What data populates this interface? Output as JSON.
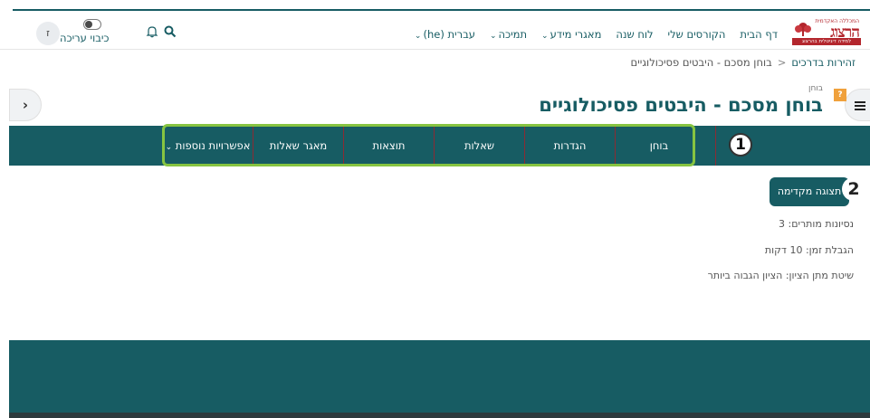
{
  "header": {
    "logo": {
      "small_text": "המכללה האקדמית",
      "main_text": "הרצוג",
      "strip_text": "למידה דיגיטלית בהרצוג"
    },
    "nav": [
      {
        "label": "דף הבית",
        "dropdown": false
      },
      {
        "label": "הקורסים שלי",
        "dropdown": false
      },
      {
        "label": "לוח שנה",
        "dropdown": false
      },
      {
        "label": "מאגרי מידע",
        "dropdown": true
      },
      {
        "label": "תמיכה",
        "dropdown": true
      },
      {
        "label": "עברית (he)",
        "dropdown": true
      }
    ],
    "edit_mode_label": "כיבוי עריכה",
    "lang_icon_text": "ז"
  },
  "breadcrumb": {
    "items": [
      "זהירות בדרכים",
      "בוחן מסכם - היבטים פסיכולוגיים"
    ],
    "separator": "<"
  },
  "page": {
    "label": "בוחן",
    "title": "בוחן מסכם - היבטים פסיכולוגיים",
    "badge": "?"
  },
  "tabs": [
    {
      "label": "בוחן",
      "dropdown": false
    },
    {
      "label": "הגדרות",
      "dropdown": false
    },
    {
      "label": "שאלות",
      "dropdown": false
    },
    {
      "label": "תוצאות",
      "dropdown": false
    },
    {
      "label": "מאגר שאלות",
      "dropdown": false
    },
    {
      "label": "אפשרויות נוספות",
      "dropdown": true
    }
  ],
  "callouts": {
    "one": "1",
    "two": "2"
  },
  "preview_button": "תצוגה מקדימה",
  "info": {
    "attempts": "נסיונות מותרים: 3",
    "time_limit": "הגבלת זמן: 10 דקות",
    "grading": "שיטת מתן הציון: הציון הגבוה ביותר"
  },
  "colors": {
    "brand": "#175c63",
    "logo_red": "#b3262d",
    "highlight": "#86c441",
    "tab_divider": "#8b2b34"
  }
}
